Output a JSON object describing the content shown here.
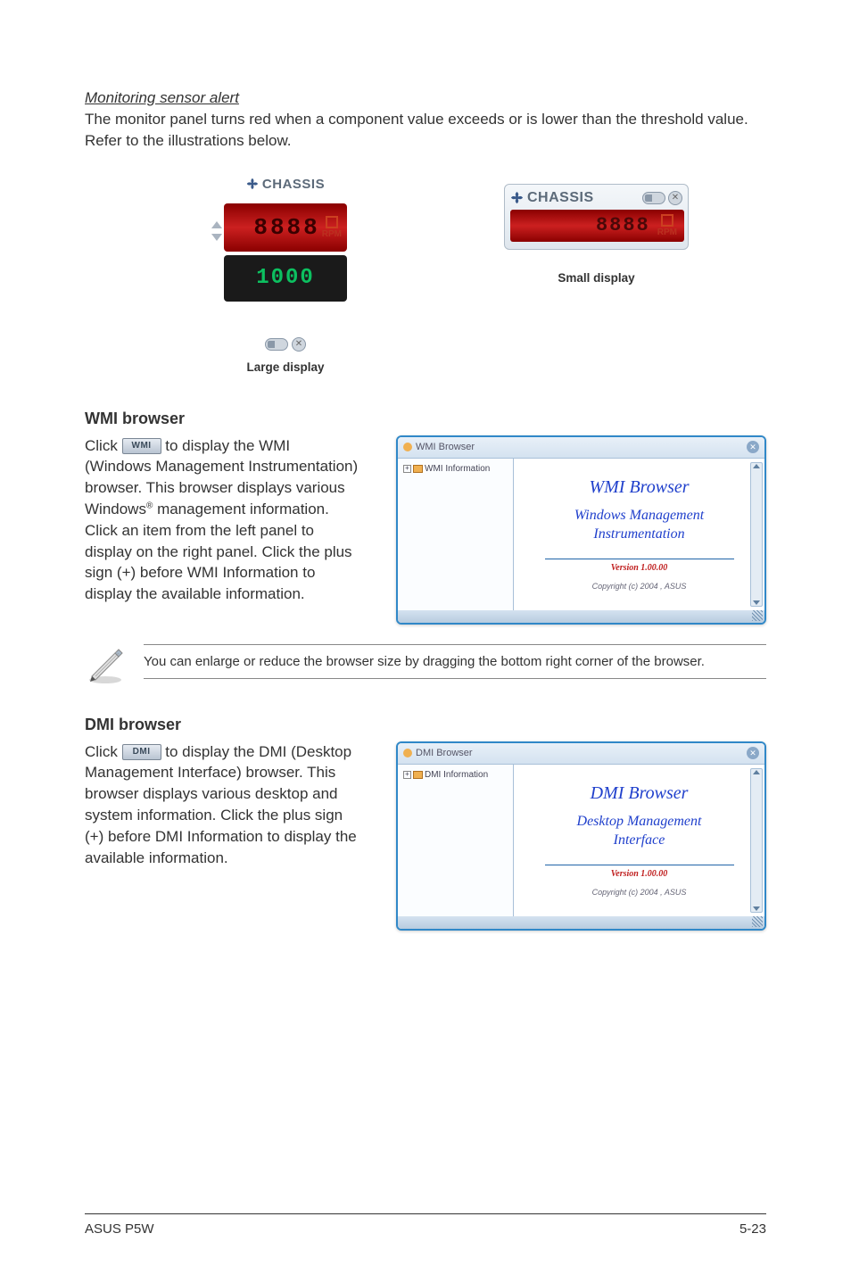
{
  "section1": {
    "subtitle": "Monitoring sensor alert",
    "body": "The monitor panel turns red when a component value exceeds or is lower than the threshold value. Refer to the illustrations below."
  },
  "large_sensor": {
    "top_label": "CHASSIS",
    "red_unit": "RPM",
    "green_value": "1000",
    "caption": "Large display"
  },
  "small_sensor": {
    "label": "CHASSIS",
    "unit": "RPM",
    "caption": "Small display"
  },
  "wmi": {
    "heading": "WMI browser",
    "body_pre": "Click ",
    "btn_label": "WMI",
    "body_post1": " to display the WMI (Windows Management Instrumentation) browser. This browser displays various Windows",
    "body_post2": " management information. Click an item from the left panel to display on the right panel. Click the plus sign (+) before WMI Information to display the available information.",
    "window": {
      "title": "WMI Browser",
      "tree_label": "WMI Information",
      "main_title": "WMI Browser",
      "main_sub": "Windows Management Instrumentation",
      "version": "Version 1.00.00",
      "copyright": "Copyright (c) 2004 , ASUS"
    }
  },
  "note": {
    "text": "You can enlarge or reduce the browser size by dragging the bottom right corner of the browser."
  },
  "dmi": {
    "heading": "DMI browser",
    "body_pre": "Click ",
    "btn_label": "DMI",
    "body_post": " to display the DMI (Desktop Management Interface) browser. This browser displays various desktop and system information. Click the plus sign (+) before DMI Information to display the available information.",
    "window": {
      "title": "DMI Browser",
      "tree_label": "DMI Information",
      "main_title": "DMI Browser",
      "main_sub": "Desktop Management Interface",
      "version": "Version 1.00.00",
      "copyright": "Copyright (c) 2004 , ASUS"
    }
  },
  "footer": {
    "left": "ASUS P5W",
    "right": "5-23"
  }
}
